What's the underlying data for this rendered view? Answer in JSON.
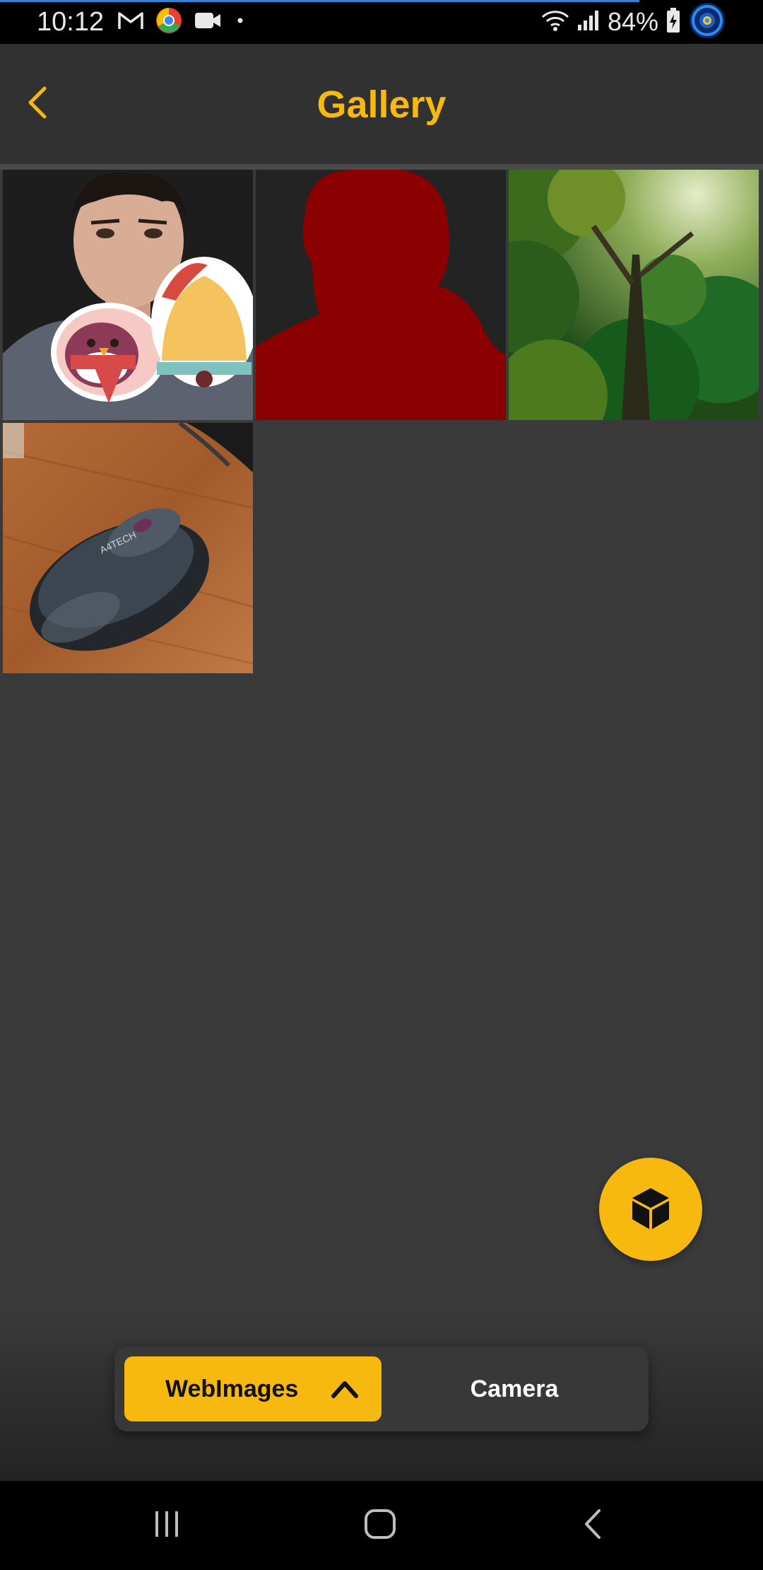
{
  "status_bar": {
    "time": "10:12",
    "battery": "84%",
    "notification_icons": [
      "gmail-icon",
      "chrome-icon",
      "video-icon",
      "dot-icon"
    ],
    "system_icons": [
      "wifi-icon",
      "signal-icon",
      "battery-icon",
      "recorder-icon"
    ]
  },
  "header": {
    "title": "Gallery",
    "back_icon": "chevron-left-icon"
  },
  "gallery": {
    "items": [
      {
        "name": "photo-man-with-stickers"
      },
      {
        "name": "photo-red-silhouette"
      },
      {
        "name": "photo-forest"
      },
      {
        "name": "photo-computer-mouse"
      }
    ]
  },
  "fab": {
    "icon": "cube-icon"
  },
  "source_switch": {
    "web_label": "WebImages",
    "camera_label": "Camera",
    "active": "WebImages"
  },
  "nav_bar": {
    "buttons": [
      "recents-icon",
      "home-icon",
      "back-icon"
    ]
  },
  "colors": {
    "accent": "#f7b80f",
    "background": "#3a3a3a",
    "header": "#313131"
  }
}
